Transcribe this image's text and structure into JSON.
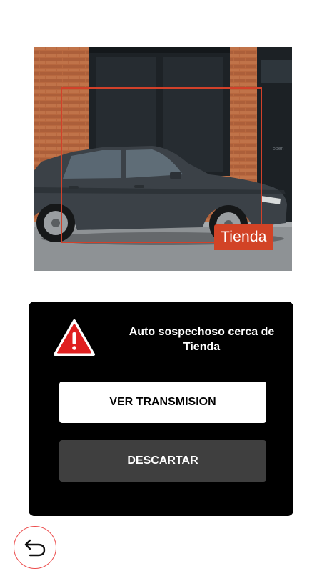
{
  "snapshot": {
    "detection_label": "Tienda",
    "storefront_sign": "open"
  },
  "alert": {
    "icon": "warning-triangle-icon",
    "message": "Auto sospechoso cerca de Tienda",
    "view_stream_label": "VER TRANSMISION",
    "dismiss_label": "DESCARTAR"
  },
  "navigation": {
    "back_icon": "undo-arrow-icon"
  },
  "colors": {
    "detection": "#d2412a",
    "card": "#000000",
    "secondary_button": "#3f3f3f",
    "back_ring": "#ec4c4c"
  }
}
